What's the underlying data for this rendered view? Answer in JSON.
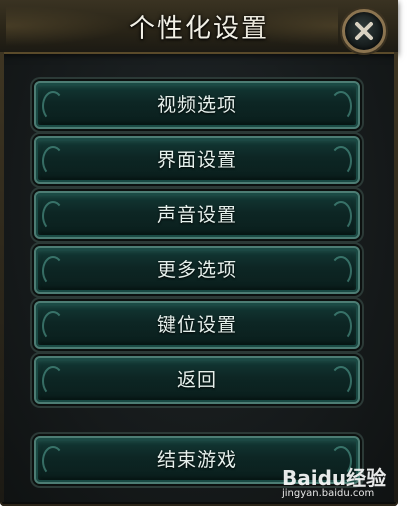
{
  "dialog": {
    "title": "个性化设置",
    "close_icon": "close-x-icon"
  },
  "menu": {
    "items": [
      {
        "label": "视频选项"
      },
      {
        "label": "界面设置"
      },
      {
        "label": "声音设置"
      },
      {
        "label": "更多选项"
      },
      {
        "label": "键位设置"
      },
      {
        "label": "返回"
      },
      {
        "label": "结束游戏"
      }
    ]
  },
  "watermark": {
    "logo": "Baidu经验",
    "url": "jingyan.baidu.com"
  },
  "colors": {
    "button_fill": "#0d2624",
    "button_border": "#4d7d74",
    "frame_gold": "#8b7450",
    "text": "#e6f0ec"
  }
}
